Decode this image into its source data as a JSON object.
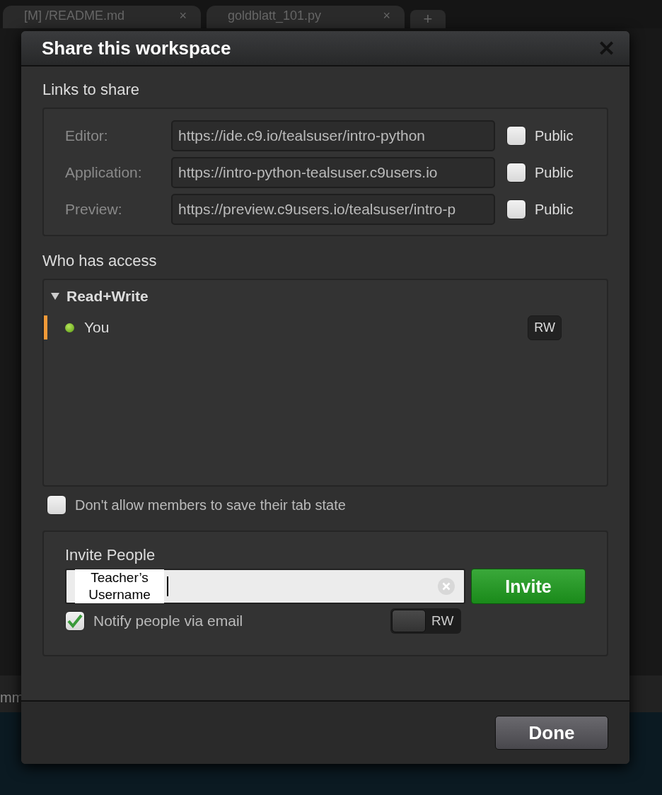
{
  "background": {
    "tabs": [
      {
        "label": "[M] /README.md",
        "close": "×",
        "selected": false
      },
      {
        "label": "goldblatt_101.py",
        "close": "×",
        "selected": false
      }
    ],
    "add_tab": "+",
    "panel_label": "mm"
  },
  "dialog": {
    "title": "Share this workspace",
    "close": "✕",
    "links": {
      "heading": "Links to share",
      "rows": [
        {
          "label": "Editor:",
          "url": "https://ide.c9.io/tealsuser/intro-python",
          "public_label": "Public",
          "checked": false
        },
        {
          "label": "Application:",
          "url": "https://intro-python-tealsuser.c9users.io",
          "public_label": "Public",
          "checked": false
        },
        {
          "label": "Preview:",
          "url": "https://preview.c9users.io/tealsuser/intro-p",
          "public_label": "Public",
          "checked": false
        }
      ]
    },
    "access": {
      "heading": "Who has access",
      "groups": [
        {
          "label": "Read+Write",
          "expanded": true,
          "members": [
            {
              "name": "You",
              "online": true,
              "selected": true,
              "permission": "RW"
            }
          ]
        }
      ]
    },
    "tab_state_option": {
      "label": "Don't allow members to save their tab state",
      "checked": false
    },
    "invite": {
      "heading": "Invite People",
      "value": "Teacher’s Username",
      "button": "Invite",
      "notify": {
        "label": "Notify people via email",
        "checked": true
      },
      "permission": {
        "label": "RW",
        "on": false
      }
    },
    "done_button": "Done"
  }
}
